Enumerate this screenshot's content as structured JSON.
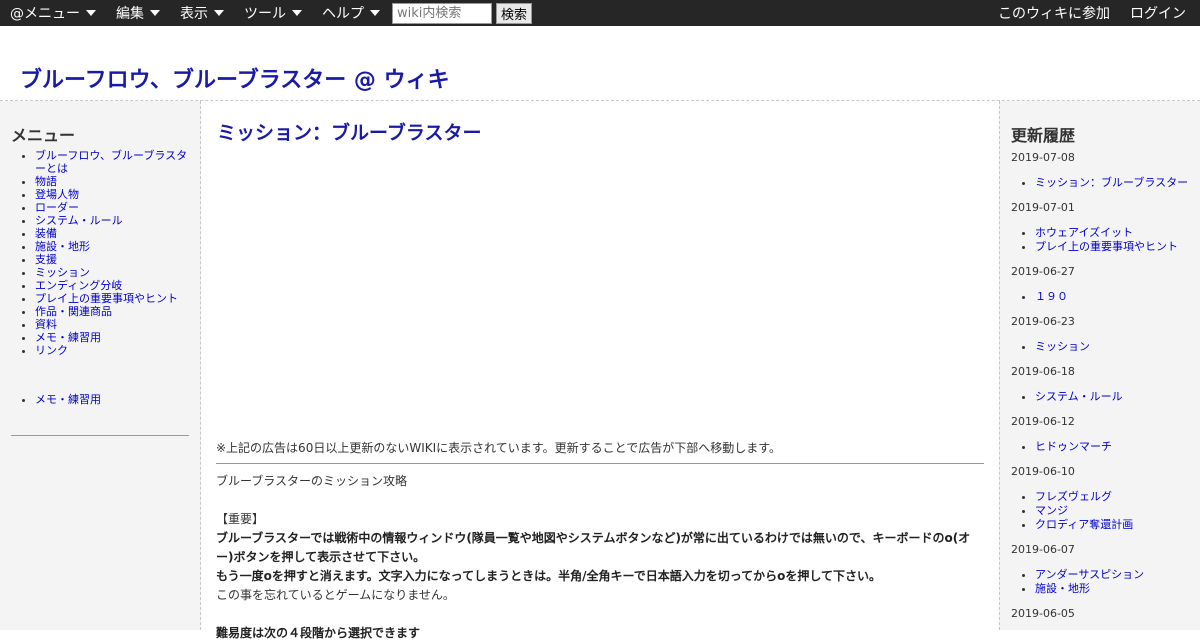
{
  "topbar": {
    "menus": [
      "@メニュー",
      "編集",
      "表示",
      "ツール",
      "ヘルプ"
    ],
    "search_placeholder": "wiki内検索",
    "search_button": "検索",
    "join": "このウィキに参加",
    "login": "ログイン"
  },
  "site": {
    "title": "ブルーフロウ、ブルーブラスター @ ウィキ"
  },
  "left": {
    "heading": "メニュー",
    "items": [
      "ブルーフロウ、ブルーブラスターとは",
      "物語",
      "登場人物",
      "ローダー",
      "システム・ルール",
      "装備",
      "施設・地形",
      "支援",
      "ミッション",
      "エンディング分岐",
      "プレイ上の重要事項やヒント",
      "作品・関連商品",
      "資料",
      "メモ・練習用",
      "リンク"
    ],
    "items2": [
      "メモ・練習用"
    ]
  },
  "main": {
    "title": "ミッション：ブルーブラスター",
    "ad_note": "※上記の広告は60日以上更新のないWIKIに表示されています。更新することで広告が下部へ移動します。",
    "intro": "ブルーブラスターのミッション攻略",
    "important_label": "【重要】",
    "bold1": "ブルーブラスターでは戦術中の情報ウィンドウ(隊員一覧や地図やシステムボタンなど)が常に出ているわけでは無いので、キーボードのo(オー)ボタンを押して表示させて下さい。",
    "bold2": "もう一度oを押すと消えます。文字入力になってしまうときは。半角/全角キーで日本語入力を切ってからoを押して下さい。",
    "normal": "この事を忘れているとゲームになりません。",
    "cut_line": "難易度は次の４段階から選択できます"
  },
  "right": {
    "heading": "更新履歴",
    "history": [
      {
        "date": "2019-07-08",
        "items": [
          "ミッション：ブルーブラスター"
        ]
      },
      {
        "date": "2019-07-01",
        "items": [
          "ホウェアイズイット",
          "プレイ上の重要事項やヒント"
        ]
      },
      {
        "date": "2019-06-27",
        "items": [
          "１９０"
        ]
      },
      {
        "date": "2019-06-23",
        "items": [
          "ミッション"
        ]
      },
      {
        "date": "2019-06-18",
        "items": [
          "システム・ルール"
        ]
      },
      {
        "date": "2019-06-12",
        "items": [
          "ヒドゥンマーチ"
        ]
      },
      {
        "date": "2019-06-10",
        "items": [
          "フレズヴェルグ",
          "マンジ",
          "クロディア奪還計画"
        ]
      },
      {
        "date": "2019-06-07",
        "items": [
          "アンダーサスピション",
          "施設・地形"
        ]
      },
      {
        "date": "2019-06-05",
        "items": []
      }
    ]
  }
}
